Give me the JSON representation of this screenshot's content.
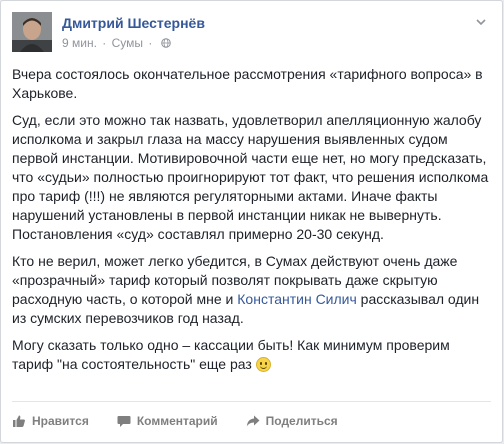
{
  "post": {
    "author": "Дмитрий Шестернёв",
    "time": "9 мин.",
    "location": "Сумы",
    "paragraphs": {
      "p1": "Вчера состоялось окончательное рассмотрения «тарифного вопроса» в Харькове.",
      "p2": "Суд, если это можно так назвать, удовлетворил апелляционную жалобу исполкома и закрыл глаза на массу нарушения выявленных судом первой инстанции. Мотивировочной части еще нет, но могу предсказать, что «судьи» полностью проигнорируют тот факт, что решения исполкома про тариф (!!!) не являются регуляторными актами. Иначе факты нарушений установлены в первой инстанции никак не вывернуть. Постановления «суд» составлял примерно 20-30 секунд.",
      "p3_before": "Кто не верил, может легко убедится, в Сумах действуют очень даже «прозрачный» тариф который позволят покрывать даже скрытую расходную часть, о которой мне и ",
      "p3_link": "Константин Силич",
      "p3_after": " рассказывал один из сумских перевозчиков год назад.",
      "p4": "Могу сказать только одно – кассации быть! Как минимум проверим тариф \"на состоятельность\" еще раз"
    }
  },
  "actions": {
    "like": "Нравится",
    "comment": "Комментарий",
    "share": "Поделиться"
  },
  "colors": {
    "link": "#365899",
    "text": "#1d2129",
    "meta": "#90949c"
  },
  "icons": {
    "avatar": "avatar",
    "globe": "globe-icon",
    "chevron": "chevron-down-icon",
    "like": "thumbs-up-icon",
    "comment": "comment-icon",
    "share": "share-icon",
    "emoji": "smile-emoji-icon"
  }
}
